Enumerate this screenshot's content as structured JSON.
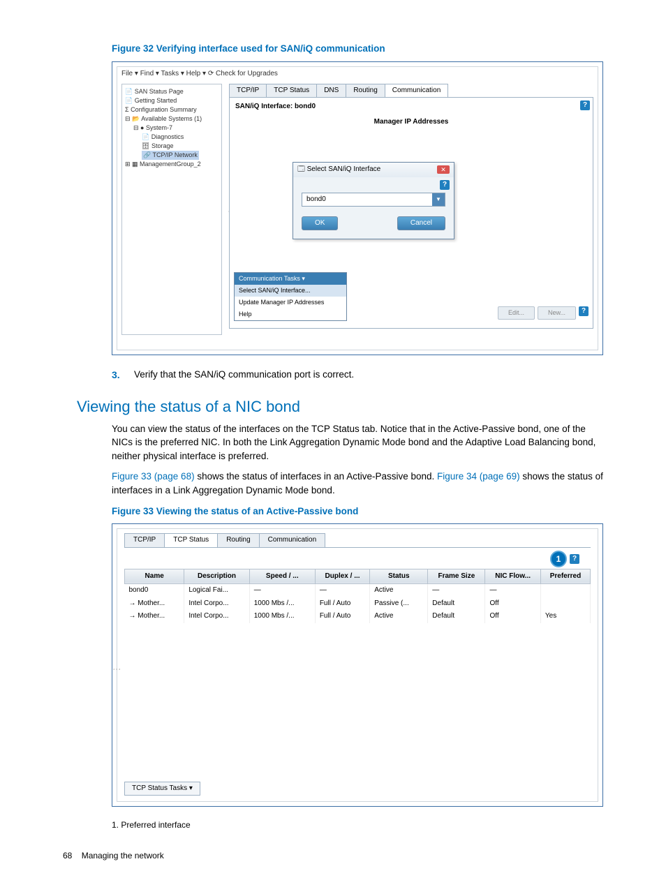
{
  "figure32": {
    "caption": "Figure 32 Verifying interface used for SAN/iQ communication",
    "menubar": "File ▾    Find ▾    Tasks ▾    Help ▾    ⟳  Check for Upgrades",
    "tree": {
      "items": [
        "SAN Status Page",
        "Getting Started",
        "Configuration Summary",
        "Available Systems (1)",
        "System-7",
        "Diagnostics",
        "Storage",
        "TCP/IP Network",
        "ManagementGroup_2"
      ],
      "selected": "TCP/IP Network"
    },
    "tabs": [
      "TCP/IP",
      "TCP Status",
      "DNS",
      "Routing",
      "Communication"
    ],
    "active_tab": "Communication",
    "saniq_label": "SAN/iQ Interface:   bond0",
    "manager_header": "Manager IP Addresses",
    "dialog": {
      "title": "Select SAN/iQ Interface",
      "value": "bond0",
      "ok": "OK",
      "cancel": "Cancel"
    },
    "task_menu": {
      "header": "Communication Tasks ▾",
      "items": [
        "Select SAN/iQ Interface...",
        "Update Manager IP Addresses",
        "Help"
      ],
      "selected": "Select SAN/iQ Interface..."
    },
    "footer_buttons": [
      "Edit...",
      "New..."
    ]
  },
  "step3": {
    "num": "3.",
    "text": "Verify that the SAN/iQ communication port is correct."
  },
  "heading2": "Viewing the status of a NIC bond",
  "para1": "You can view the status of the interfaces on the TCP Status tab. Notice that in the Active-Passive bond, one of the NICs is the preferred NIC. In both the Link Aggregation Dynamic Mode bond and the Adaptive Load Balancing bond, neither physical interface is preferred.",
  "para2_pre": "",
  "para2_link1": "Figure 33 (page 68)",
  "para2_mid": " shows the status of interfaces in an Active-Passive bond. ",
  "para2_link2": "Figure 34 (page 69)",
  "para2_post": " shows the status of interfaces in a Link Aggregation Dynamic Mode bond.",
  "figure33": {
    "caption": "Figure 33 Viewing the status of an Active-Passive bond",
    "tabs": [
      "TCP/IP",
      "TCP Status",
      "Routing",
      "Communication"
    ],
    "active_tab": "TCP Status",
    "callout_num": "1",
    "columns": [
      "Name",
      "Description",
      "Speed / ...",
      "Duplex / ...",
      "Status",
      "Frame Size",
      "NIC Flow...",
      "Preferred"
    ],
    "rows": [
      {
        "c": [
          "bond0",
          "Logical Fai...",
          "—",
          "—",
          "Active",
          "—",
          "—",
          ""
        ]
      },
      {
        "c": [
          "→ Mother...",
          "Intel Corpo...",
          "1000 Mbs /...",
          "Full / Auto",
          "Passive (...",
          "Default",
          "Off",
          ""
        ]
      },
      {
        "c": [
          "→ Mother...",
          "Intel Corpo...",
          "1000 Mbs /...",
          "Full / Auto",
          "Active",
          "Default",
          "Off",
          "Yes"
        ]
      }
    ],
    "tasks_bar": "TCP Status Tasks ▾"
  },
  "legend1": "1. Preferred interface",
  "footer": {
    "page": "68",
    "section": "Managing the network"
  }
}
